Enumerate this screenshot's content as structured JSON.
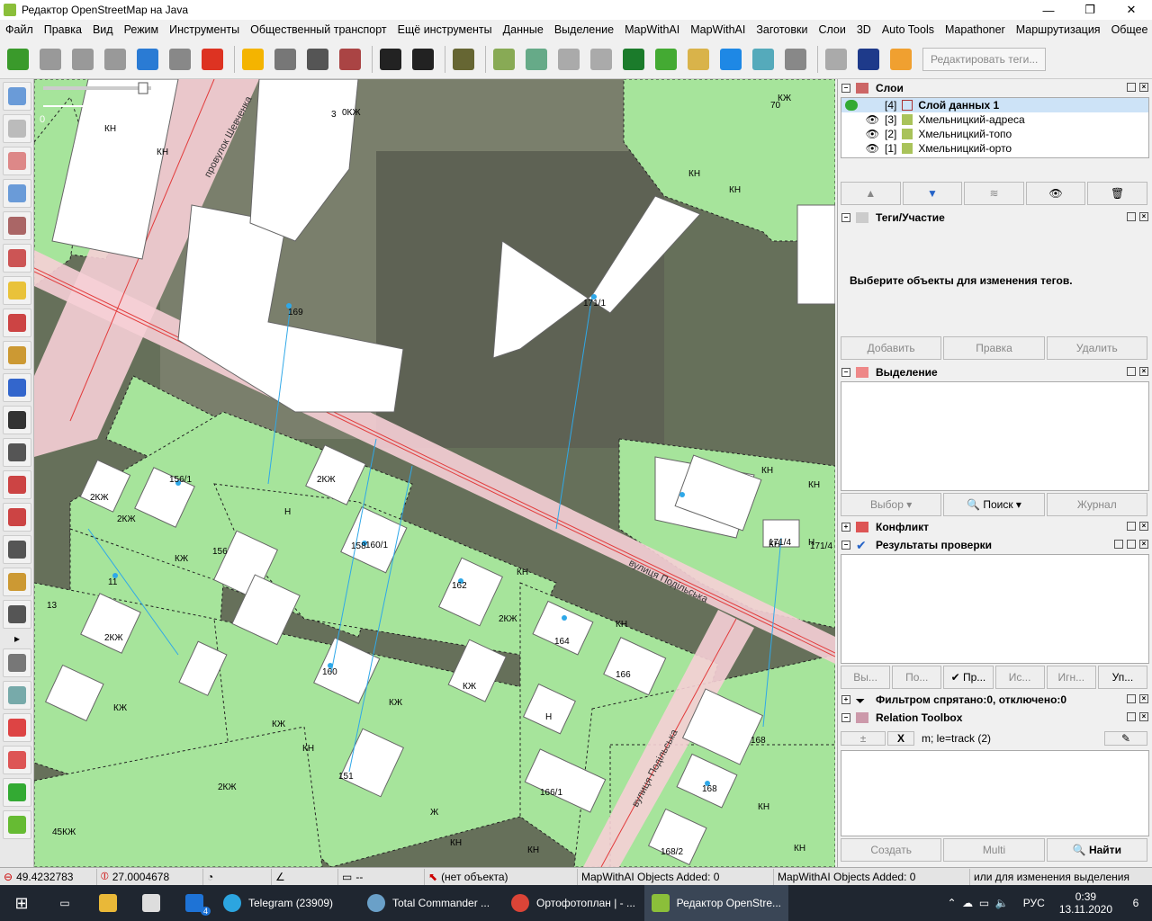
{
  "window": {
    "title": "Редактор OpenStreetMap на Java",
    "min": "—",
    "max": "❐",
    "close": "✕"
  },
  "menu": [
    "Файл",
    "Правка",
    "Вид",
    "Режим",
    "Инструменты",
    "Общественный транспорт",
    "Ещё инструменты",
    "Данные",
    "Выделение",
    "MapWithAI",
    "MapWithAI",
    "Заготовки",
    "Слои",
    "3D",
    "Auto Tools",
    "Mapathoner",
    "Маршрутизация",
    "Общее"
  ],
  "toolbar": {
    "edit_tags_label": "Редактировать теги...",
    "icons": [
      "download-icon",
      "upload-icon",
      "undo-icon",
      "redo-icon",
      "zoom-icon",
      "preferences-icon",
      "split-icon",
      "sep",
      "road-yellow-icon",
      "road-gray-icon",
      "traffic-light-icon",
      "wall-icon",
      "sep",
      "car-icon",
      "bus-icon",
      "sep",
      "restaurant-icon",
      "sep",
      "industrial-icon",
      "landfill-icon",
      "quarry-icon",
      "construction-icon",
      "forest-icon",
      "grass-icon",
      "farmland-icon",
      "water-icon",
      "wetland-icon",
      "scrub-icon",
      "sep",
      "route-icon",
      "number-icon",
      "josm-x-icon"
    ]
  },
  "left_tools": [
    "select-icon",
    "lasso-icon",
    "draw-line-icon",
    "zoom-tool-icon",
    "delete-icon",
    "improve-way-icon",
    "area-icon",
    "parallel-icon",
    "pencil-line-icon",
    "split-way-icon",
    "bus-stop-icon",
    "vehicle-icon",
    "measure-icon",
    "points-icon",
    "hand-icon",
    "edit-icon",
    "building-icon",
    "expand-icon",
    "layers-icon",
    "tag-icon",
    "validator-icon",
    "relation-icon",
    "map-icon",
    "refresh-icon"
  ],
  "map": {
    "street_labels": [
      "провулок Шевченка",
      "вулиця Подільська",
      "вулиця Подільська"
    ],
    "scale": {
      "start": "0",
      "end": "10.0 m"
    },
    "building_labels": [
      "КН",
      "КН",
      "3",
      "0КЖ",
      "70",
      "КЖ",
      "169",
      "171/1",
      "КН",
      "КН",
      "КН",
      "КН",
      "171/4",
      "КН",
      "Н",
      "171/4",
      "2КЖ",
      "156/1",
      "2КЖ",
      "2КЖ",
      "КЖ",
      "156",
      "Н",
      "158",
      "160/1",
      "11",
      "13",
      "2КЖ",
      "162",
      "КН",
      "2КЖ",
      "164",
      "КН",
      "166",
      "160",
      "КЖ",
      "Н",
      "КЖ",
      "КЖ",
      "КН",
      "151",
      "Ж",
      "166/1",
      "168",
      "168",
      "КН",
      "КН",
      "45КЖ",
      "КН",
      "168/2",
      "КН",
      "2КЖ",
      "КЖ"
    ]
  },
  "panels": {
    "layers": {
      "title": "Слои",
      "rows": [
        {
          "idx": "[4]",
          "name": "Слой данных 1",
          "active": true
        },
        {
          "idx": "[3]",
          "name": "Хмельницкий-адреса",
          "active": false
        },
        {
          "idx": "[2]",
          "name": "Хмельницкий-топо",
          "active": false
        },
        {
          "idx": "[1]",
          "name": "Хмельницкий-орто",
          "active": false
        }
      ]
    },
    "tags": {
      "title": "Теги/Участие",
      "empty_text": "Выберите объекты для изменения тегов.",
      "add": "Добавить",
      "edit": "Правка",
      "delete": "Удалить"
    },
    "selection": {
      "title": "Выделение",
      "select": "Выбор",
      "search": "Поиск",
      "history": "Журнал"
    },
    "conflict": {
      "title": "Конфликт"
    },
    "validation": {
      "title": "Результаты проверки",
      "b1": "Вы...",
      "b2": "По...",
      "b3": "Пр...",
      "b4": "Ис...",
      "b5": "Игн...",
      "b6": "Уп..."
    },
    "filter": {
      "title": "Фильтром спрятано:0, отключено:0"
    },
    "relation": {
      "title": "Relation Toolbox",
      "x": "X",
      "text": "m; le=track (2)",
      "create": "Создать",
      "multi": "Multi",
      "find": "Найти"
    }
  },
  "status": {
    "lat": "49.4232783",
    "lon": "27.0004678",
    "dist": "--",
    "object": "(нет объекта)",
    "mwa1": "MapWithAI Objects Added: 0",
    "mwa2": "MapWithAI Objects Added: 0",
    "hint": "или для изменения выделения"
  },
  "taskbar": {
    "items": [
      {
        "label": "Telegram (23909)"
      },
      {
        "label": "Total Commander ..."
      },
      {
        "label": "Ортофотоплан | - ..."
      },
      {
        "label": "Редактор OpenStre..."
      }
    ],
    "mail_badge": "4",
    "lang": "РУС",
    "time": "0:39",
    "date": "13.11.2020",
    "notif": "6"
  }
}
